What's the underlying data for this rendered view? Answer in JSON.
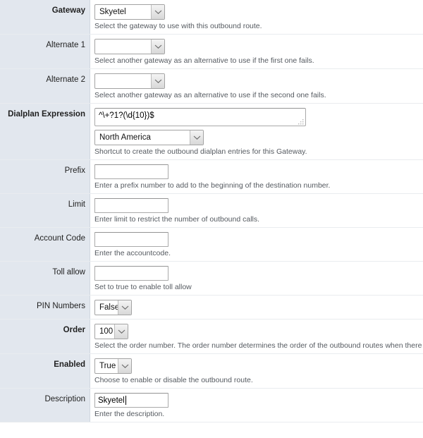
{
  "form": {
    "rows": [
      {
        "id": "gateway",
        "label": "Gateway",
        "required": true,
        "control": "select",
        "value": "Skyetel",
        "hint": "Select the gateway to use with this outbound route."
      },
      {
        "id": "alternate-1",
        "label": "Alternate 1",
        "required": false,
        "control": "select",
        "value": "",
        "hint": "Select another gateway as an alternative to use if the first one fails."
      },
      {
        "id": "alternate-2",
        "label": "Alternate 2",
        "required": false,
        "control": "select",
        "value": "",
        "hint": "Select another gateway as an alternative to use if the second one fails."
      },
      {
        "id": "dialplan-expression",
        "label": "Dialplan Expression",
        "required": true,
        "control": "textarea-plus-select",
        "value": "^\\+?1?(\\d{10})$",
        "select_value": "North America",
        "hint": "Shortcut to create the outbound dialplan entries for this Gateway."
      },
      {
        "id": "prefix",
        "label": "Prefix",
        "required": false,
        "control": "text",
        "value": "",
        "hint": "Enter a prefix number to add to the beginning of the destination number."
      },
      {
        "id": "limit",
        "label": "Limit",
        "required": false,
        "control": "text",
        "value": "",
        "hint": "Enter limit to restrict the number of outbound calls."
      },
      {
        "id": "account-code",
        "label": "Account Code",
        "required": false,
        "control": "text",
        "value": "",
        "hint": "Enter the accountcode."
      },
      {
        "id": "toll-allow",
        "label": "Toll allow",
        "required": false,
        "control": "text",
        "value": "",
        "hint": "Set to true to enable toll allow"
      },
      {
        "id": "pin-numbers",
        "label": "PIN Numbers",
        "required": false,
        "control": "select",
        "value": "False",
        "hint": ""
      },
      {
        "id": "order",
        "label": "Order",
        "required": true,
        "control": "select",
        "value": "100",
        "hint": "Select the order number. The order number determines the order of the outbound routes when there is more than one."
      },
      {
        "id": "enabled",
        "label": "Enabled",
        "required": true,
        "control": "select",
        "value": "True",
        "hint": "Choose to enable or disable the outbound route."
      },
      {
        "id": "description",
        "label": "Description",
        "required": false,
        "control": "text",
        "value": "Skyetel",
        "hint": "Enter the description."
      }
    ]
  },
  "icons": {
    "dropdown_arrow": "chevron-down-icon",
    "resize_grip": "resize-grip-icon"
  },
  "colors": {
    "label_background": "#e2e7ee",
    "label_border": "#d0d7e0",
    "row_divider": "#e9ecef",
    "field_background": "#ffffff",
    "hint_text": "#555a60",
    "input_border": "#a9a9a9"
  }
}
